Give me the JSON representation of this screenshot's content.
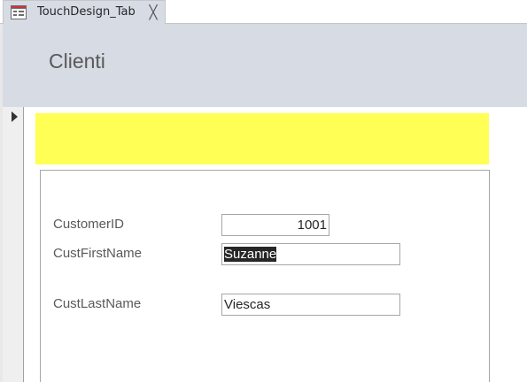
{
  "tab": {
    "title": "TouchDesign_Tab",
    "close_glyph": "╳",
    "icon": "form-icon"
  },
  "header": {
    "title": "Clienti"
  },
  "record_selector": {
    "icon": "current-record-arrow-icon"
  },
  "colors": {
    "header_bg": "#d6dbe4",
    "banner": "#ffff55"
  },
  "fields": {
    "customer_id": {
      "label": "CustomerID",
      "value": "1001"
    },
    "cust_first_name": {
      "label": "CustFirstName",
      "value": "Suzanne"
    },
    "cust_last_name": {
      "label": "CustLastName",
      "value": "Viescas"
    }
  }
}
